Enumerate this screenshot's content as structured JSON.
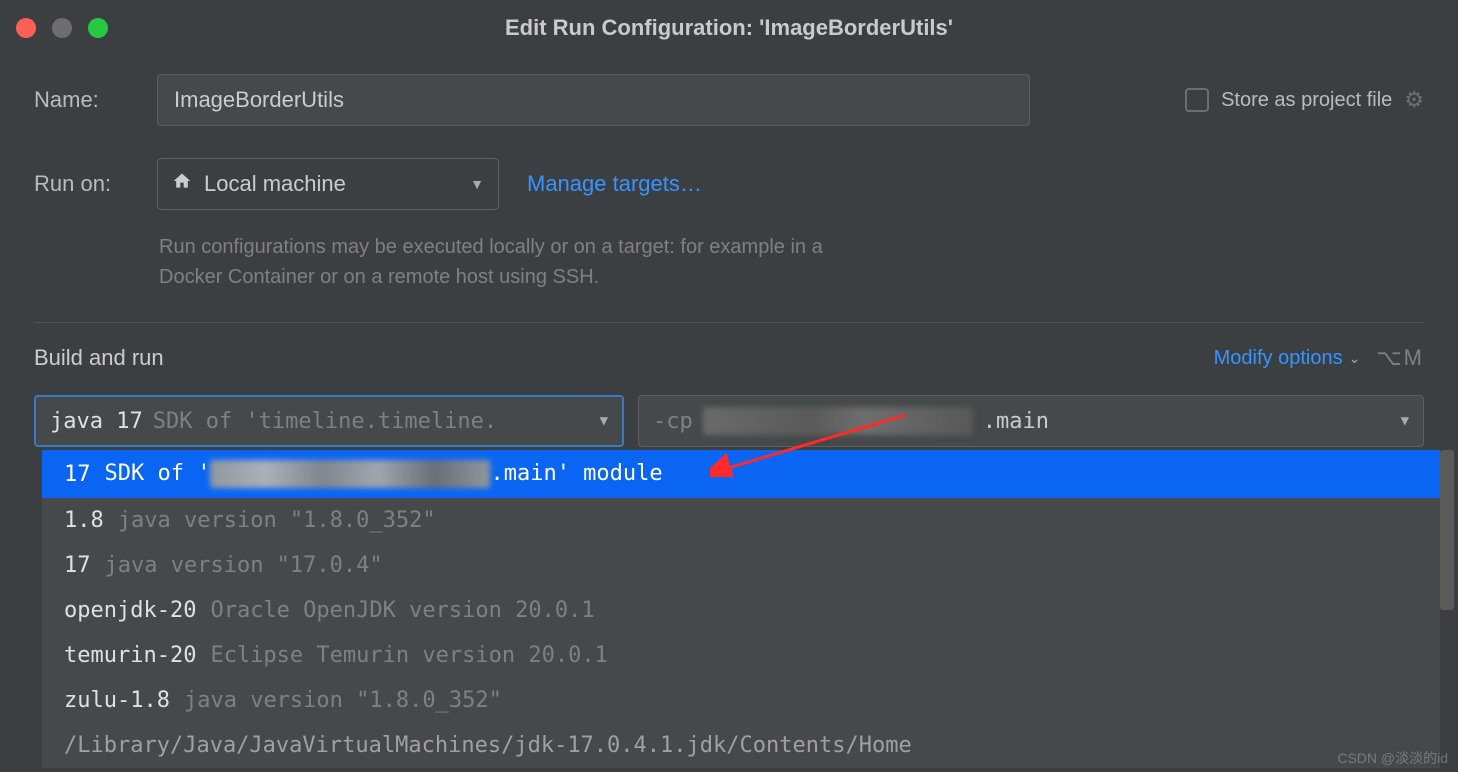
{
  "title": "Edit Run Configuration: 'ImageBorderUtils'",
  "name_label": "Name:",
  "name_value": "ImageBorderUtils",
  "store_label": "Store as project file",
  "run_on_label": "Run on:",
  "run_on_value": "Local machine",
  "manage_targets": "Manage targets…",
  "help_text": "Run configurations may be executed locally or on a target: for example in a Docker Container or on a remote host using SSH.",
  "section_title": "Build and run",
  "modify_options": "Modify options",
  "modify_shortcut": "⌥M",
  "jdk": {
    "name": "java 17",
    "detail": "SDK of 'timeline.timeline."
  },
  "cp": {
    "prefix": "-cp",
    "suffix": ".main"
  },
  "dropdown": [
    {
      "name": "17",
      "detail_prefix": "SDK of '",
      "detail_suffix": ".main' module",
      "blurred": true,
      "selected": true
    },
    {
      "name": "1.8",
      "detail": "java version \"1.8.0_352\""
    },
    {
      "name": "17",
      "detail": "java version \"17.0.4\""
    },
    {
      "name": "openjdk-20",
      "detail": "Oracle OpenJDK version 20.0.1"
    },
    {
      "name": "temurin-20",
      "detail": "Eclipse Temurin version 20.0.1"
    },
    {
      "name": "zulu-1.8",
      "detail": "java version \"1.8.0_352\""
    },
    {
      "path": "/Library/Java/JavaVirtualMachines/jdk-17.0.4.1.jdk/Contents/Home"
    }
  ],
  "watermark": "CSDN @淡淡的id"
}
